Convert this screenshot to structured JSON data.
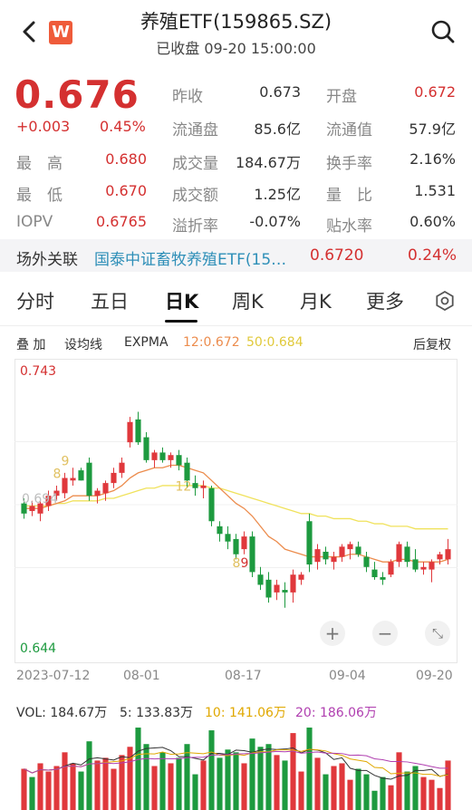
{
  "header": {
    "title": "养殖ETF(159865.SZ)",
    "subtitle": "已收盘 09-20 15:00:00",
    "logo_text": "W"
  },
  "quote": {
    "price": "0.676",
    "change": "+0.003",
    "change_pct": "0.45%",
    "rows": [
      [
        {
          "label": "昨收",
          "value": "0.673"
        },
        {
          "label": "开盘",
          "value": "0.672"
        }
      ],
      [
        {
          "label": "流通盘",
          "value": "85.6亿"
        },
        {
          "label": "流通值",
          "value": "57.9亿"
        }
      ],
      [
        {
          "label": "成交量",
          "value": "184.67万"
        },
        {
          "label": "换手率",
          "value": "2.16%"
        }
      ],
      [
        {
          "label": "成交额",
          "value": "1.25亿"
        },
        {
          "label": "量　比",
          "value": "1.531"
        }
      ],
      [
        {
          "label": "溢折率",
          "value": "-0.07%"
        },
        {
          "label": "贴水率",
          "value": "0.60%"
        }
      ]
    ],
    "left_rows": [
      {
        "label": "最　高",
        "value": "0.680"
      },
      {
        "label": "最　低",
        "value": "0.670"
      },
      {
        "label": "IOPV",
        "value": "0.6765"
      }
    ]
  },
  "offsite": {
    "label": "场外关联",
    "name": "国泰中证畜牧养殖ETF(15…",
    "price": "0.6720",
    "pct": "0.24%"
  },
  "tabs": [
    "分时",
    "五日",
    "日K",
    "周K",
    "月K",
    "更多"
  ],
  "indicator_bar": {
    "stack": "叠 加",
    "setma": "设均线",
    "expma": "EXPMA",
    "ma12": "12:0.672",
    "ma50": "50:0.684",
    "adjust": "后复权"
  },
  "chart_data": {
    "type": "candlestick",
    "ylim": [
      0.644,
      0.743
    ],
    "y_top_label": "0.743",
    "y_bottom_label": "0.644",
    "x_labels": [
      "2023-07-12",
      "08-01",
      "08-17",
      "09-04",
      "09-20"
    ],
    "annotations": [
      "9",
      "8",
      "12",
      "8",
      "9"
    ],
    "faint_label": "0.694",
    "candles": [
      {
        "o": 0.694,
        "h": 0.696,
        "l": 0.688,
        "c": 0.69
      },
      {
        "o": 0.691,
        "h": 0.695,
        "l": 0.689,
        "c": 0.693
      },
      {
        "o": 0.69,
        "h": 0.696,
        "l": 0.687,
        "c": 0.694
      },
      {
        "o": 0.693,
        "h": 0.699,
        "l": 0.691,
        "c": 0.697
      },
      {
        "o": 0.697,
        "h": 0.701,
        "l": 0.695,
        "c": 0.699
      },
      {
        "o": 0.698,
        "h": 0.706,
        "l": 0.696,
        "c": 0.704
      },
      {
        "o": 0.703,
        "h": 0.708,
        "l": 0.701,
        "c": 0.704
      },
      {
        "o": 0.707,
        "h": 0.708,
        "l": 0.703,
        "c": 0.703
      },
      {
        "o": 0.71,
        "h": 0.712,
        "l": 0.695,
        "c": 0.697
      },
      {
        "o": 0.697,
        "h": 0.7,
        "l": 0.694,
        "c": 0.699
      },
      {
        "o": 0.698,
        "h": 0.703,
        "l": 0.695,
        "c": 0.702
      },
      {
        "o": 0.702,
        "h": 0.708,
        "l": 0.7,
        "c": 0.706
      },
      {
        "o": 0.706,
        "h": 0.712,
        "l": 0.704,
        "c": 0.71
      },
      {
        "o": 0.718,
        "h": 0.728,
        "l": 0.716,
        "c": 0.726
      },
      {
        "o": 0.727,
        "h": 0.73,
        "l": 0.717,
        "c": 0.718
      },
      {
        "o": 0.72,
        "h": 0.722,
        "l": 0.71,
        "c": 0.711
      },
      {
        "o": 0.711,
        "h": 0.715,
        "l": 0.708,
        "c": 0.714
      },
      {
        "o": 0.714,
        "h": 0.716,
        "l": 0.71,
        "c": 0.711
      },
      {
        "o": 0.711,
        "h": 0.714,
        "l": 0.708,
        "c": 0.713
      },
      {
        "o": 0.713,
        "h": 0.715,
        "l": 0.707,
        "c": 0.709
      },
      {
        "o": 0.71,
        "h": 0.712,
        "l": 0.7,
        "c": 0.703
      },
      {
        "o": 0.702,
        "h": 0.705,
        "l": 0.697,
        "c": 0.7
      },
      {
        "o": 0.7,
        "h": 0.703,
        "l": 0.696,
        "c": 0.701
      },
      {
        "o": 0.7,
        "h": 0.701,
        "l": 0.685,
        "c": 0.687
      },
      {
        "o": 0.685,
        "h": 0.687,
        "l": 0.679,
        "c": 0.682
      },
      {
        "o": 0.682,
        "h": 0.685,
        "l": 0.676,
        "c": 0.679
      },
      {
        "o": 0.68,
        "h": 0.682,
        "l": 0.672,
        "c": 0.674
      },
      {
        "o": 0.676,
        "h": 0.683,
        "l": 0.674,
        "c": 0.681
      },
      {
        "o": 0.681,
        "h": 0.683,
        "l": 0.665,
        "c": 0.667
      },
      {
        "o": 0.666,
        "h": 0.669,
        "l": 0.66,
        "c": 0.662
      },
      {
        "o": 0.664,
        "h": 0.667,
        "l": 0.655,
        "c": 0.657
      },
      {
        "o": 0.659,
        "h": 0.664,
        "l": 0.656,
        "c": 0.662
      },
      {
        "o": 0.66,
        "h": 0.663,
        "l": 0.653,
        "c": 0.659
      },
      {
        "o": 0.659,
        "h": 0.668,
        "l": 0.655,
        "c": 0.666
      },
      {
        "o": 0.664,
        "h": 0.667,
        "l": 0.662,
        "c": 0.666
      },
      {
        "o": 0.687,
        "h": 0.69,
        "l": 0.667,
        "c": 0.67
      },
      {
        "o": 0.671,
        "h": 0.678,
        "l": 0.668,
        "c": 0.676
      },
      {
        "o": 0.675,
        "h": 0.677,
        "l": 0.67,
        "c": 0.672
      },
      {
        "o": 0.671,
        "h": 0.675,
        "l": 0.668,
        "c": 0.673
      },
      {
        "o": 0.673,
        "h": 0.678,
        "l": 0.671,
        "c": 0.677
      },
      {
        "o": 0.676,
        "h": 0.679,
        "l": 0.672,
        "c": 0.678
      },
      {
        "o": 0.677,
        "h": 0.679,
        "l": 0.673,
        "c": 0.674
      },
      {
        "o": 0.673,
        "h": 0.675,
        "l": 0.667,
        "c": 0.669
      },
      {
        "o": 0.668,
        "h": 0.671,
        "l": 0.664,
        "c": 0.665
      },
      {
        "o": 0.665,
        "h": 0.667,
        "l": 0.662,
        "c": 0.664
      },
      {
        "o": 0.666,
        "h": 0.672,
        "l": 0.665,
        "c": 0.671
      },
      {
        "o": 0.671,
        "h": 0.679,
        "l": 0.669,
        "c": 0.678
      },
      {
        "o": 0.677,
        "h": 0.679,
        "l": 0.669,
        "c": 0.671
      },
      {
        "o": 0.672,
        "h": 0.676,
        "l": 0.667,
        "c": 0.668
      },
      {
        "o": 0.668,
        "h": 0.671,
        "l": 0.666,
        "c": 0.669
      },
      {
        "o": 0.668,
        "h": 0.672,
        "l": 0.663,
        "c": 0.671
      },
      {
        "o": 0.672,
        "h": 0.675,
        "l": 0.67,
        "c": 0.674
      },
      {
        "o": 0.672,
        "h": 0.68,
        "l": 0.67,
        "c": 0.676
      }
    ],
    "ema12": [
      0.692,
      0.692,
      0.692,
      0.693,
      0.694,
      0.695,
      0.697,
      0.697,
      0.697,
      0.697,
      0.698,
      0.699,
      0.701,
      0.704,
      0.706,
      0.707,
      0.708,
      0.708,
      0.709,
      0.709,
      0.708,
      0.707,
      0.706,
      0.703,
      0.7,
      0.697,
      0.694,
      0.692,
      0.689,
      0.685,
      0.681,
      0.679,
      0.676,
      0.675,
      0.674,
      0.673,
      0.673,
      0.673,
      0.673,
      0.673,
      0.674,
      0.674,
      0.673,
      0.672,
      0.671,
      0.671,
      0.672,
      0.672,
      0.671,
      0.671,
      0.671,
      0.671,
      0.672
    ],
    "ema50": [
      0.693,
      0.693,
      0.693,
      0.693,
      0.694,
      0.694,
      0.695,
      0.695,
      0.695,
      0.695,
      0.696,
      0.696,
      0.697,
      0.698,
      0.699,
      0.7,
      0.7,
      0.701,
      0.701,
      0.701,
      0.701,
      0.701,
      0.701,
      0.7,
      0.7,
      0.699,
      0.698,
      0.697,
      0.696,
      0.695,
      0.694,
      0.693,
      0.692,
      0.691,
      0.69,
      0.69,
      0.689,
      0.689,
      0.688,
      0.688,
      0.688,
      0.687,
      0.687,
      0.686,
      0.686,
      0.685,
      0.685,
      0.685,
      0.684,
      0.684,
      0.684,
      0.684,
      0.684
    ]
  },
  "volume": {
    "vol": "VOL: 184.67万",
    "ma5": "5: 133.83万",
    "ma10": "10: 141.06万",
    "ma20": "20: 186.06万",
    "bars": [
      150,
      120,
      170,
      140,
      160,
      210,
      170,
      140,
      250,
      180,
      190,
      150,
      200,
      230,
      300,
      240,
      160,
      210,
      170,
      190,
      240,
      130,
      180,
      290,
      190,
      220,
      210,
      170,
      260,
      230,
      240,
      200,
      180,
      280,
      140,
      300,
      190,
      130,
      160,
      170,
      110,
      150,
      130,
      70,
      120,
      90,
      210,
      140,
      160,
      120,
      110,
      80,
      180
    ],
    "colors": [
      "#e0383c",
      "#1d9a3f",
      "#e0383c",
      "#e0383c",
      "#e0383c",
      "#e0383c",
      "#e0383c",
      "#1d9a3f",
      "#1d9a3f",
      "#e0383c",
      "#e0383c",
      "#e0383c",
      "#e0383c",
      "#e0383c",
      "#1d9a3f",
      "#1d9a3f",
      "#e0383c",
      "#1d9a3f",
      "#e0383c",
      "#1d9a3f",
      "#1d9a3f",
      "#1d9a3f",
      "#e0383c",
      "#1d9a3f",
      "#1d9a3f",
      "#1d9a3f",
      "#1d9a3f",
      "#e0383c",
      "#1d9a3f",
      "#1d9a3f",
      "#1d9a3f",
      "#e0383c",
      "#1d9a3f",
      "#e0383c",
      "#e0383c",
      "#1d9a3f",
      "#e0383c",
      "#1d9a3f",
      "#e0383c",
      "#e0383c",
      "#e0383c",
      "#1d9a3f",
      "#1d9a3f",
      "#1d9a3f",
      "#1d9a3f",
      "#e0383c",
      "#e0383c",
      "#1d9a3f",
      "#1d9a3f",
      "#e0383c",
      "#e0383c",
      "#e0383c",
      "#e0383c"
    ]
  },
  "colors": {
    "up": "#e0383c",
    "down": "#1d9a3f",
    "ema12": "#ec8c4d",
    "ema50": "#f0e25c",
    "text_red": "#d43030"
  }
}
